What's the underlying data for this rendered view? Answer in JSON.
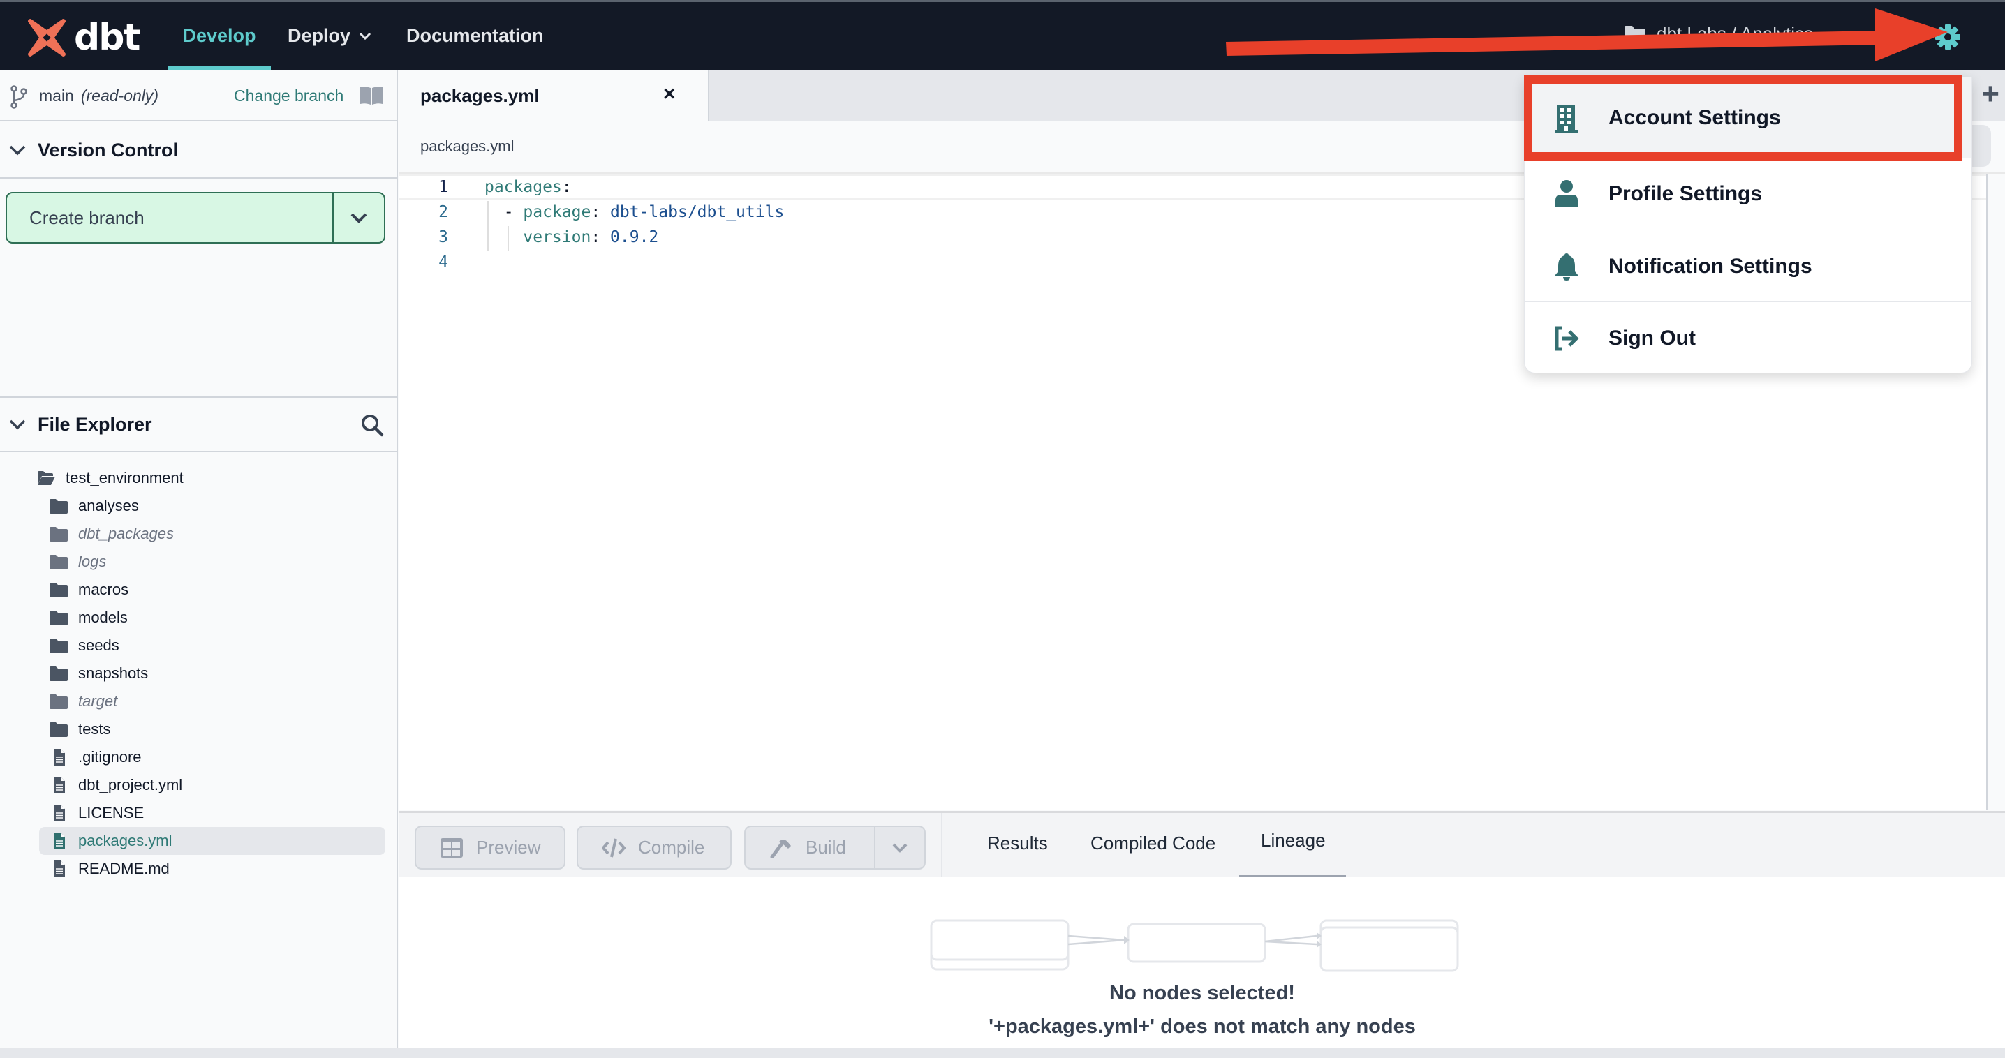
{
  "header": {
    "logo_text": "dbt",
    "nav": [
      {
        "label": "Develop",
        "active": true
      },
      {
        "label": "Deploy",
        "has_dropdown": true
      },
      {
        "label": "Documentation"
      }
    ],
    "project_breadcrumb": "dbt Labs / Analytics",
    "help_icon": "?",
    "accent_color": "#5ecbcc"
  },
  "sidebar": {
    "branch": {
      "name": "main",
      "mode": "(read-only)",
      "change_label": "Change branch"
    },
    "version_control": {
      "title": "Version Control",
      "create_branch_label": "Create branch"
    },
    "file_explorer": {
      "title": "File Explorer",
      "root": "test_environment",
      "items": [
        {
          "name": "analyses",
          "type": "folder"
        },
        {
          "name": "dbt_packages",
          "type": "folder",
          "ignored": true
        },
        {
          "name": "logs",
          "type": "folder",
          "ignored": true
        },
        {
          "name": "macros",
          "type": "folder"
        },
        {
          "name": "models",
          "type": "folder"
        },
        {
          "name": "seeds",
          "type": "folder"
        },
        {
          "name": "snapshots",
          "type": "folder"
        },
        {
          "name": "target",
          "type": "folder",
          "ignored": true
        },
        {
          "name": "tests",
          "type": "folder"
        },
        {
          "name": ".gitignore",
          "type": "file"
        },
        {
          "name": "dbt_project.yml",
          "type": "file"
        },
        {
          "name": "LICENSE",
          "type": "file"
        },
        {
          "name": "packages.yml",
          "type": "file",
          "selected": true
        },
        {
          "name": "README.md",
          "type": "file"
        }
      ]
    }
  },
  "editor": {
    "tab": {
      "label": "packages.yml",
      "close": "×"
    },
    "new_tab": "+",
    "breadcrumb": "packages.yml",
    "lines": [
      {
        "n": "1",
        "key": "packages",
        "value": ""
      },
      {
        "n": "2",
        "prefix": "- ",
        "key": "package",
        "value": "dbt-labs/dbt_utils"
      },
      {
        "n": "3",
        "key": "version",
        "value": "0.9.2"
      },
      {
        "n": "4"
      }
    ]
  },
  "bottom_panel": {
    "buttons": {
      "preview": "Preview",
      "compile": "Compile",
      "build": "Build"
    },
    "tabs": {
      "results": "Results",
      "compiled": "Compiled Code",
      "lineage": "Lineage",
      "active": "Lineage"
    },
    "lineage": {
      "title": "No nodes selected!",
      "message": "'+packages.yml+' does not match any nodes"
    }
  },
  "user_menu": {
    "items": [
      {
        "label": "Account Settings",
        "icon": "building-icon",
        "highlighted": true
      },
      {
        "label": "Profile Settings",
        "icon": "user-icon"
      },
      {
        "label": "Notification Settings",
        "icon": "bell-icon"
      },
      {
        "label": "Sign Out",
        "icon": "sign-out-icon"
      }
    ]
  },
  "annotation": {
    "color": "#e8402a",
    "target": "Account Settings"
  }
}
